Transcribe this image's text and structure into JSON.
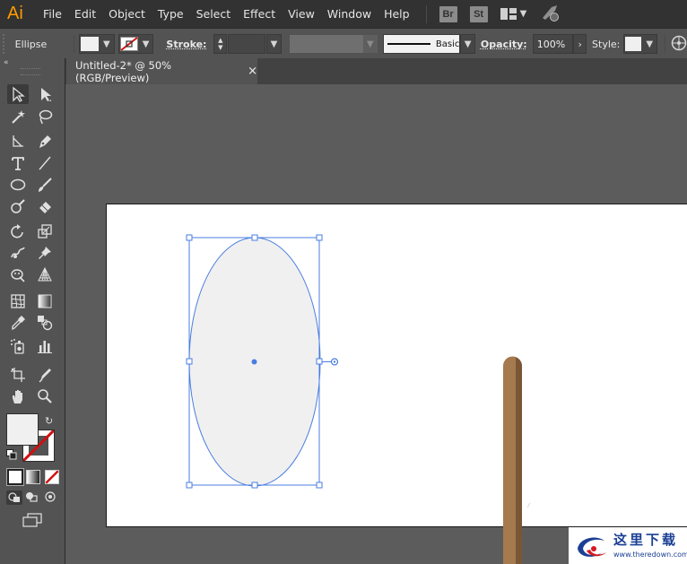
{
  "app": {
    "logo": "Ai"
  },
  "menu": [
    "File",
    "Edit",
    "Object",
    "Type",
    "Select",
    "Effect",
    "View",
    "Window",
    "Help"
  ],
  "bridge": {
    "br": "Br",
    "st": "St"
  },
  "control_bar": {
    "selection_type": "Ellipse",
    "stroke_label": "Stroke:",
    "brush_label": "Basic",
    "opacity_label": "Opacity:",
    "opacity_value": "100%",
    "style_label": "Style:"
  },
  "document": {
    "tab_title": "Untitled-2* @ 50% (RGB/Preview)",
    "close_glyph": "×"
  },
  "colors": {
    "fill": "#f0f0f0",
    "selection": "#4a7ee0",
    "stick_main": "#a57a4e",
    "stick_dark": "#7a5636",
    "logo": "#ff9a00"
  },
  "tools": [
    "selection-tool",
    "direct-selection-tool",
    "magic-wand-tool",
    "lasso-tool",
    "line-segment-tool",
    "pen-tool",
    "type-tool",
    "line-tool",
    "ellipse-tool",
    "paintbrush-tool",
    "shaper-tool",
    "eraser-tool",
    "rotate-tool",
    "scale-tool",
    "warp-tool",
    "puppet-warp-tool",
    "free-transform-tool",
    "perspective-grid-tool",
    "mesh-tool",
    "gradient-tool",
    "eyedropper-tool",
    "blend-tool",
    "symbol-sprayer-tool",
    "column-graph-tool",
    "artboard-tool",
    "slice-tool",
    "hand-tool",
    "zoom-tool"
  ],
  "watermark": {
    "chinese": "这里下载",
    "url": "www.theredown.com"
  }
}
